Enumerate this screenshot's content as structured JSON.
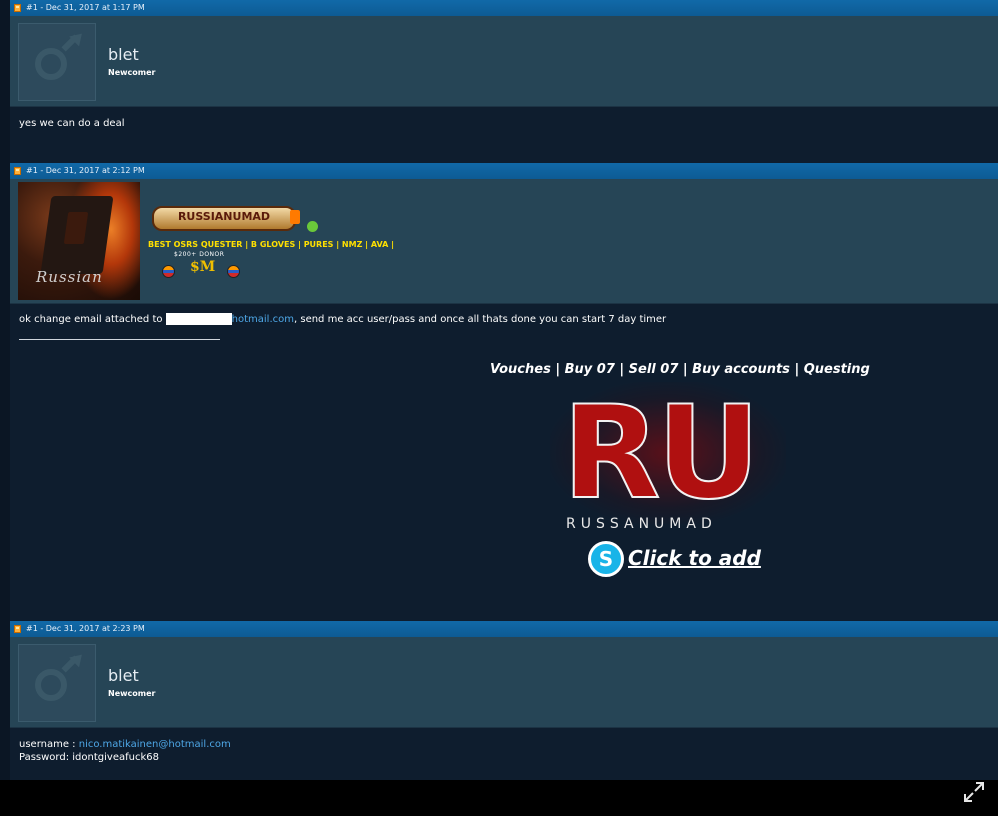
{
  "posts": [
    {
      "header": "#1 - Dec 31, 2017 at 1:17 PM",
      "username": "blet",
      "usertitle": "Newcomer",
      "message": "yes we can do a deal"
    },
    {
      "header": "#1 - Dec 31, 2017 at 2:12 PM",
      "name_logo": "RUSSIANUMAD",
      "avatar_text": "Russian",
      "tagline": "BEST OSRS QUESTER | B GLOVES | PURES | NMZ | AVA |",
      "donor_label": "$200+ DONOR",
      "message_prefix": "ok change email attached to ",
      "message_link": "hotmail.com",
      "message_suffix": ", send me acc user/pass and once all thats done you can start 7 day timer",
      "signature": {
        "links": "Vouches | Buy 07 | Sell 07 | Buy accounts | Questing",
        "logo_letters": "RU",
        "logo_word": "RUSSANUMAD",
        "skype_letter": "S",
        "skype_text": "Click to add"
      }
    },
    {
      "header": "#1 - Dec 31, 2017 at 2:23 PM",
      "username": "blet",
      "usertitle": "Newcomer",
      "username_label": "username : ",
      "username_value": "nico.matikainen@hotmail.com",
      "password_label": "Password: ",
      "password_value": "idontgiveafuck68"
    }
  ],
  "colors": {
    "header_blue": "#1169a8",
    "user_bar": "#264556",
    "post_body": "#0e1d2e",
    "link": "#4ea7e6",
    "tagline": "#ffe000"
  },
  "icons": [
    "male-default-avatar-icon",
    "post-pin-icon",
    "online-status-icon",
    "skype-icon",
    "fullscreen-expand-icon"
  ]
}
